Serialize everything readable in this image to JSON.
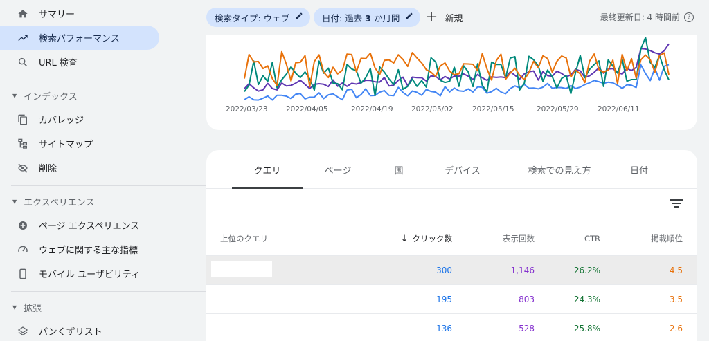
{
  "sidebar": {
    "items": [
      {
        "label": "サマリー",
        "icon": "home-icon"
      },
      {
        "label": "検索パフォーマンス",
        "icon": "trending-up-icon"
      },
      {
        "label": "URL 検査",
        "icon": "search-icon"
      }
    ],
    "sections": [
      {
        "title": "インデックス",
        "items": [
          {
            "label": "カバレッジ",
            "icon": "copy-pages-icon"
          },
          {
            "label": "サイトマップ",
            "icon": "sitemap-icon"
          },
          {
            "label": "削除",
            "icon": "eye-off-icon"
          }
        ]
      },
      {
        "title": "エクスペリエンス",
        "items": [
          {
            "label": "ページ エクスペリエンス",
            "icon": "plus-circle-icon"
          },
          {
            "label": "ウェブに関する主な指標",
            "icon": "gauge-icon"
          },
          {
            "label": "モバイル ユーザビリティ",
            "icon": "phone-icon"
          }
        ]
      },
      {
        "title": "拡張",
        "items": [
          {
            "label": "パンくずリスト",
            "icon": "layers-icon"
          }
        ]
      }
    ]
  },
  "toolbar": {
    "filter_type": "検索タイプ: ウェブ",
    "filter_date_prefix": "日付: 過去 ",
    "filter_date_num": "3",
    "filter_date_suffix": " か月間",
    "new_label": "新規",
    "updated": "最終更新日: 4 時間前"
  },
  "chart_data": {
    "type": "line",
    "x_tick_labels": [
      "2022/03/23",
      "2022/04/05",
      "2022/04/19",
      "2022/05/02",
      "2022/05/15",
      "2022/05/29",
      "2022/06/11"
    ],
    "series": [
      {
        "metric": "clicks",
        "color": "#4285f4"
      },
      {
        "metric": "impressions",
        "color": "#5e35b1"
      },
      {
        "metric": "ctr",
        "color": "#00897b"
      },
      {
        "metric": "position",
        "color": "#e8710a"
      }
    ],
    "grid": false,
    "legend": "none"
  },
  "tabs": [
    "クエリ",
    "ページ",
    "国",
    "デバイス",
    "検索での見え方",
    "日付"
  ],
  "table": {
    "headers": {
      "query": "上位のクエリ",
      "sort_arrow": "↓",
      "clicks": "クリック数",
      "impressions": "表示回数",
      "ctr": "CTR",
      "position": "掲載順位"
    },
    "rows": [
      {
        "query": "",
        "clicks": "300",
        "impressions": "1,146",
        "ctr": "26.2%",
        "position": "4.5"
      },
      {
        "query": "",
        "clicks": "195",
        "impressions": "803",
        "ctr": "24.3%",
        "position": "3.5"
      },
      {
        "query": "",
        "clicks": "136",
        "impressions": "528",
        "ctr": "25.8%",
        "position": "2.6"
      }
    ]
  },
  "colors": {
    "clicks": "#1a73e8",
    "impressions": "#8430ce",
    "ctr": "#137333",
    "position": "#e8710a",
    "chip_bg": "#d3e3fd"
  }
}
